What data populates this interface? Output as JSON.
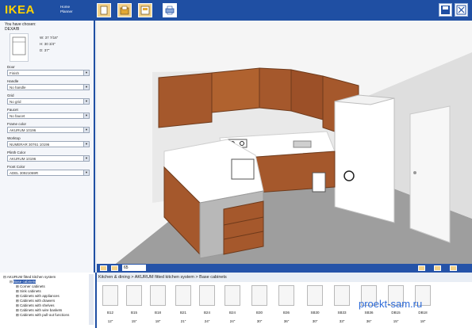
{
  "app": {
    "logo": "IKEA",
    "logo_sub": "Home Planner"
  },
  "toolbar": {
    "left_icons": [
      "new-file-icon",
      "open-file-icon",
      "save-file-icon",
      "export-icon",
      "print-icon"
    ],
    "right_icons": [
      "save-disk-icon",
      "close-icon"
    ]
  },
  "chosen": {
    "title": "You have chosen:",
    "code": "DEXA!B",
    "width": "W: 37 7/16\"",
    "height": "H: 30 3/4\"",
    "depth": "D: 37\""
  },
  "options": [
    {
      "label": "Door",
      "value": "Finish"
    },
    {
      "label": "Handle",
      "value": "No handle"
    },
    {
      "label": "Grid",
      "value": "No grid"
    },
    {
      "label": "Faucet",
      "value": "No faucet"
    },
    {
      "label": "Frame color",
      "value": "AKURUM 10196"
    },
    {
      "label": "Worktop",
      "value": "NUMERAR 30761 10196"
    },
    {
      "label": "Plinth Color",
      "value": "AKURUM 10196"
    },
    {
      "label": "Front Color",
      "value": "ADEL 30921069R"
    }
  ],
  "nav": {
    "zoom": "65"
  },
  "tree": {
    "root": "AKURUM fitted kitchen system",
    "selected": "Base cabinets",
    "children": [
      "Corner cabinets",
      "Sink cabinets",
      "Cabinets with appliances",
      "Cabinets with drawers",
      "Cabinets with shelves",
      "Cabinets with wire baskets",
      "Cabinets with pull-out functions"
    ]
  },
  "breadcrumb": "Kitchen & dining > AKURUM fitted kitchen system > Base cabinets",
  "items": [
    {
      "code": "B12",
      "width": "12\""
    },
    {
      "code": "B15",
      "width": "15\""
    },
    {
      "code": "B18",
      "width": "18\""
    },
    {
      "code": "B21",
      "width": "21\""
    },
    {
      "code": "B24",
      "width": "24\""
    },
    {
      "code": "B24",
      "width": "24\""
    },
    {
      "code": "B30",
      "width": "30\""
    },
    {
      "code": "B36",
      "width": "36\""
    },
    {
      "code": "SB30",
      "width": "30\""
    },
    {
      "code": "SB33",
      "width": "33\""
    },
    {
      "code": "SB36",
      "width": "36\""
    },
    {
      "code": "DB15",
      "width": "15\""
    },
    {
      "code": "DB18",
      "width": "18\""
    }
  ],
  "watermark": "proekt-sam.ru",
  "colors": {
    "toolbar": "#1f4fa3",
    "logo": "#ffd200",
    "wood": "#a5582c",
    "counter": "#ffffff"
  }
}
